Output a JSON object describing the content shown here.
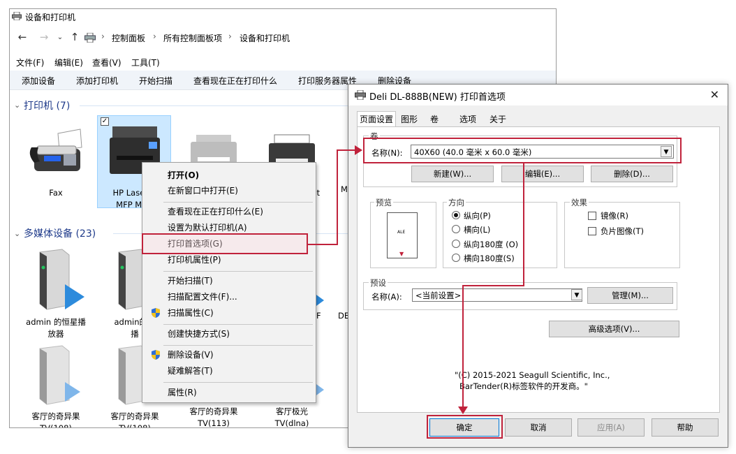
{
  "explorer": {
    "title": "设备和打印机",
    "breadcrumbs": [
      "控制面板",
      "所有控制面板项",
      "设备和打印机"
    ],
    "menu": [
      "文件(F)",
      "编辑(E)",
      "查看(V)",
      "工具(T)"
    ],
    "toolbar": [
      "添加设备",
      "添加打印机",
      "开始扫描",
      "查看现在正在打印什么",
      "打印服务器属性",
      "删除设备"
    ],
    "printers_group": "打印机 (7)",
    "printers": [
      {
        "label": "Fax"
      },
      {
        "label_line1": "HP LaserJe",
        "label_line2": "MFP M12"
      },
      {
        "label": ""
      },
      {
        "label": "nt"
      },
      {
        "label": "M"
      }
    ],
    "media_group": "多媒体设备 (23)",
    "media_row1": [
      {
        "line1": "admin 的恒星播",
        "line2": "放器"
      },
      {
        "line1": "admin的刀",
        "line2": "播"
      },
      {
        "line1": "F"
      },
      {
        "line1": "DE"
      }
    ],
    "media_row2": [
      {
        "line1": "客厅的奇异果",
        "line2": "TV(108)"
      },
      {
        "line1": "客厅的奇异果",
        "line2": "TV(108)"
      },
      {
        "line1": "客厅的奇异果",
        "line2": "TV(113)"
      },
      {
        "line1": "客厅极光",
        "line2": "TV(dlna)"
      }
    ]
  },
  "context_menu": {
    "items": [
      "打开(O)",
      "在新窗口中打开(E)",
      "查看现在正在打印什么(E)",
      "设置为默认打印机(A)",
      "打印首选项(G)",
      "打印机属性(P)",
      "开始扫描(T)",
      "扫描配置文件(F)...",
      "扫描属性(C)",
      "创建快捷方式(S)",
      "删除设备(V)",
      "疑难解答(T)",
      "属性(R)"
    ]
  },
  "dialog": {
    "title": "Deli DL-888B(NEW) 打印首选项",
    "tabs": [
      "页面设置",
      "图形",
      "卷",
      "选项",
      "关于"
    ],
    "roll_group": "卷",
    "name_label": "名称(N):",
    "name_value": "40X60 (40.0 毫米 x 60.0 毫米)",
    "btn_new": "新建(W)...",
    "btn_edit": "编辑(E)...",
    "btn_delete": "删除(D)...",
    "preview_group": "预览",
    "preview_text": "ALE",
    "orientation_group": "方向",
    "orientation": [
      "纵向(P)",
      "横向(L)",
      "纵向180度 (O)",
      "横向180度(S)"
    ],
    "orientation_selected": 0,
    "effects_group": "效果",
    "effects": [
      "镜像(R)",
      "负片图像(T)"
    ],
    "preset_group": "预设",
    "preset_label": "名称(A):",
    "preset_value": "<当前设置>",
    "btn_manage": "管理(M)...",
    "btn_advanced": "高级选项(V)...",
    "copyright_line1": "\"(C) 2015-2021 Seagull Scientific, Inc.,",
    "copyright_line2": "BarTender(R)标签软件的开发商。\"",
    "btn_ok": "确定",
    "btn_cancel": "取消",
    "btn_apply": "应用(A)",
    "btn_help": "帮助"
  },
  "colors": {
    "highlight": "#c0223b",
    "selection": "#cce8ff",
    "link_blue": "#1e3a8a"
  }
}
